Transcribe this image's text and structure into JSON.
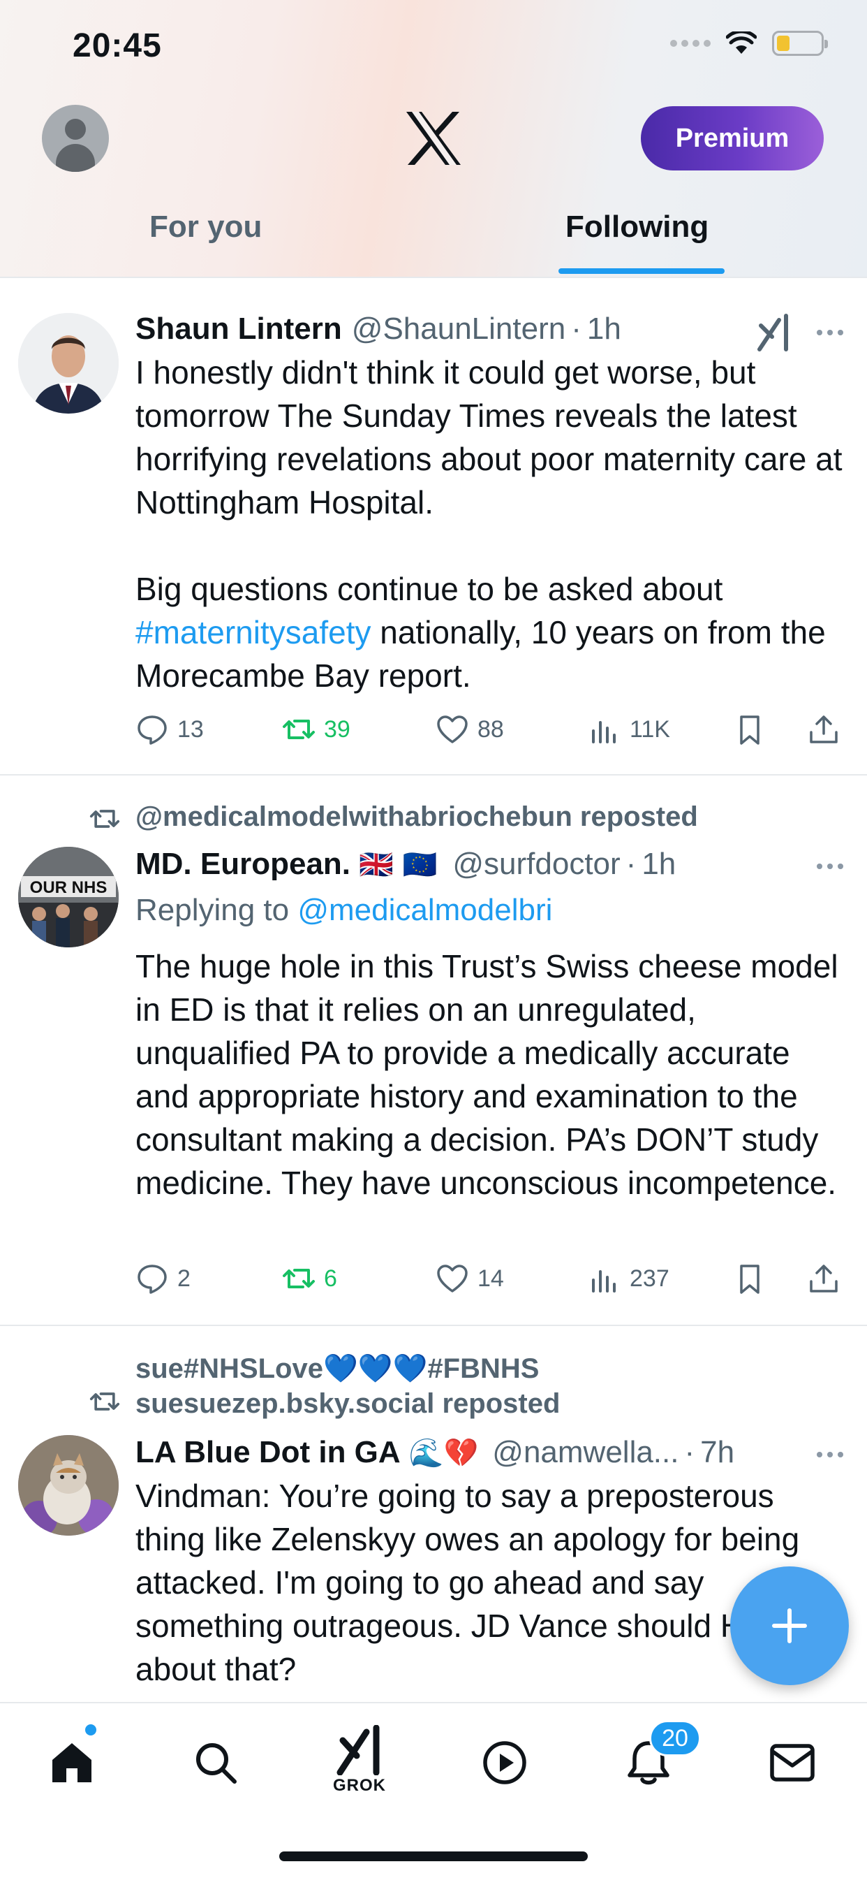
{
  "status_bar": {
    "time": "20:45"
  },
  "header": {
    "premium_label": "Premium",
    "tabs": [
      {
        "label": "For you",
        "active": false
      },
      {
        "label": "Following",
        "active": true
      }
    ]
  },
  "tweets": [
    {
      "display_name": "Shaun Lintern",
      "handle": "@ShaunLintern",
      "time": "1h",
      "text_lines_1": "I honestly didn't think it could get worse, but tomorrow The Sunday Times reveals the latest horrifying revelations about poor maternity care at Nottingham Hospital.",
      "text_p2_hashtag": "#maternitysafety",
      "text_p2_rest": " nationally, 10 years on from the Morecambe Bay report.",
      "text_p2_start": "Big questions continue to be asked about ",
      "replies": "13",
      "reposts": "39",
      "likes": "88",
      "views": "11K"
    },
    {
      "reposted_by": "@medicalmodelwithabriochebun reposted",
      "display_name": "MD. European.",
      "flags": "🇬🇧 🇪🇺",
      "handle": "@surfdoctor",
      "time": "1h",
      "avatar_text": "OUR NHS",
      "replying_prefix": "Replying to ",
      "replying_to": "@medicalmodelbri",
      "text": "The huge hole in this Trust’s Swiss cheese model in ED is that it relies on an unregulated, unqualified PA to provide a medically accurate and appropriate history and examination to the consultant making a decision. PA’s DON’T study medicine. They have unconscious incompetence.",
      "replies": "2",
      "reposts": "6",
      "likes": "14",
      "views": "237"
    },
    {
      "reposted_by_line1": "sue#NHSLove💙💙💙#FBNHS",
      "reposted_by_line2": "suesuezep.bsky.social reposted",
      "display_name": "LA Blue Dot in GA",
      "emojis": "🌊💔",
      "handle": "@namwella...",
      "time": "7h",
      "text": "Vindman: You’re going to say a preposterous thing like Zelenskyy owes an apology for being attacked. I'm going to go ahead and say something outrageous. JD Vance should How about that?"
    }
  ],
  "bottom_nav": {
    "grok_label": "GROK",
    "notifications_count": "20"
  },
  "colors": {
    "accent": "#1d9bf0",
    "repost_green": "#17bf63",
    "secondary_text": "#536471",
    "premium_gradient_start": "#4a2aa8",
    "premium_gradient_end": "#9b5fd9"
  }
}
